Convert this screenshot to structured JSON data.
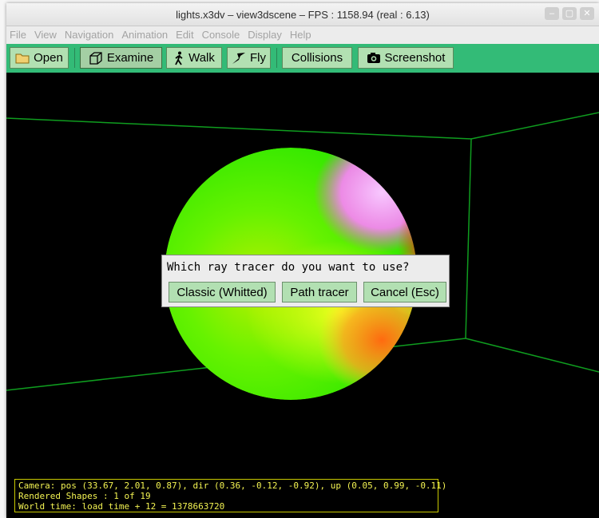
{
  "window": {
    "title": "lights.x3dv – view3dscene – FPS : 1158.94 (real : 6.13)",
    "controls": [
      "–",
      "▢",
      "✕"
    ]
  },
  "menu": [
    "File",
    "View",
    "Navigation",
    "Animation",
    "Edit",
    "Console",
    "Display",
    "Help"
  ],
  "toolbar": {
    "open": "Open",
    "examine": "Examine",
    "walk": "Walk",
    "fly": "Fly",
    "collisions": "Collisions",
    "screenshot": "Screenshot"
  },
  "dialog": {
    "message": "Which ray tracer do you want to use?",
    "classic": "Classic (Whitted)",
    "path": "Path tracer",
    "cancel": "Cancel (Esc)"
  },
  "status": {
    "camera": "Camera: pos (33.67, 2.01, 0.87), dir (0.36, -0.12, -0.92), up (0.05, 0.99, -0.11)",
    "shapes": "Rendered Shapes : 1 of 19",
    "time": "World time: load time + 12 = 1378663720"
  },
  "colors": {
    "toolbar_bg": "#33bb77",
    "button_bg": "#b2e0b2",
    "status_text": "#f3f352",
    "status_border": "#c9c900",
    "room_lines": "#0f9d1f"
  }
}
